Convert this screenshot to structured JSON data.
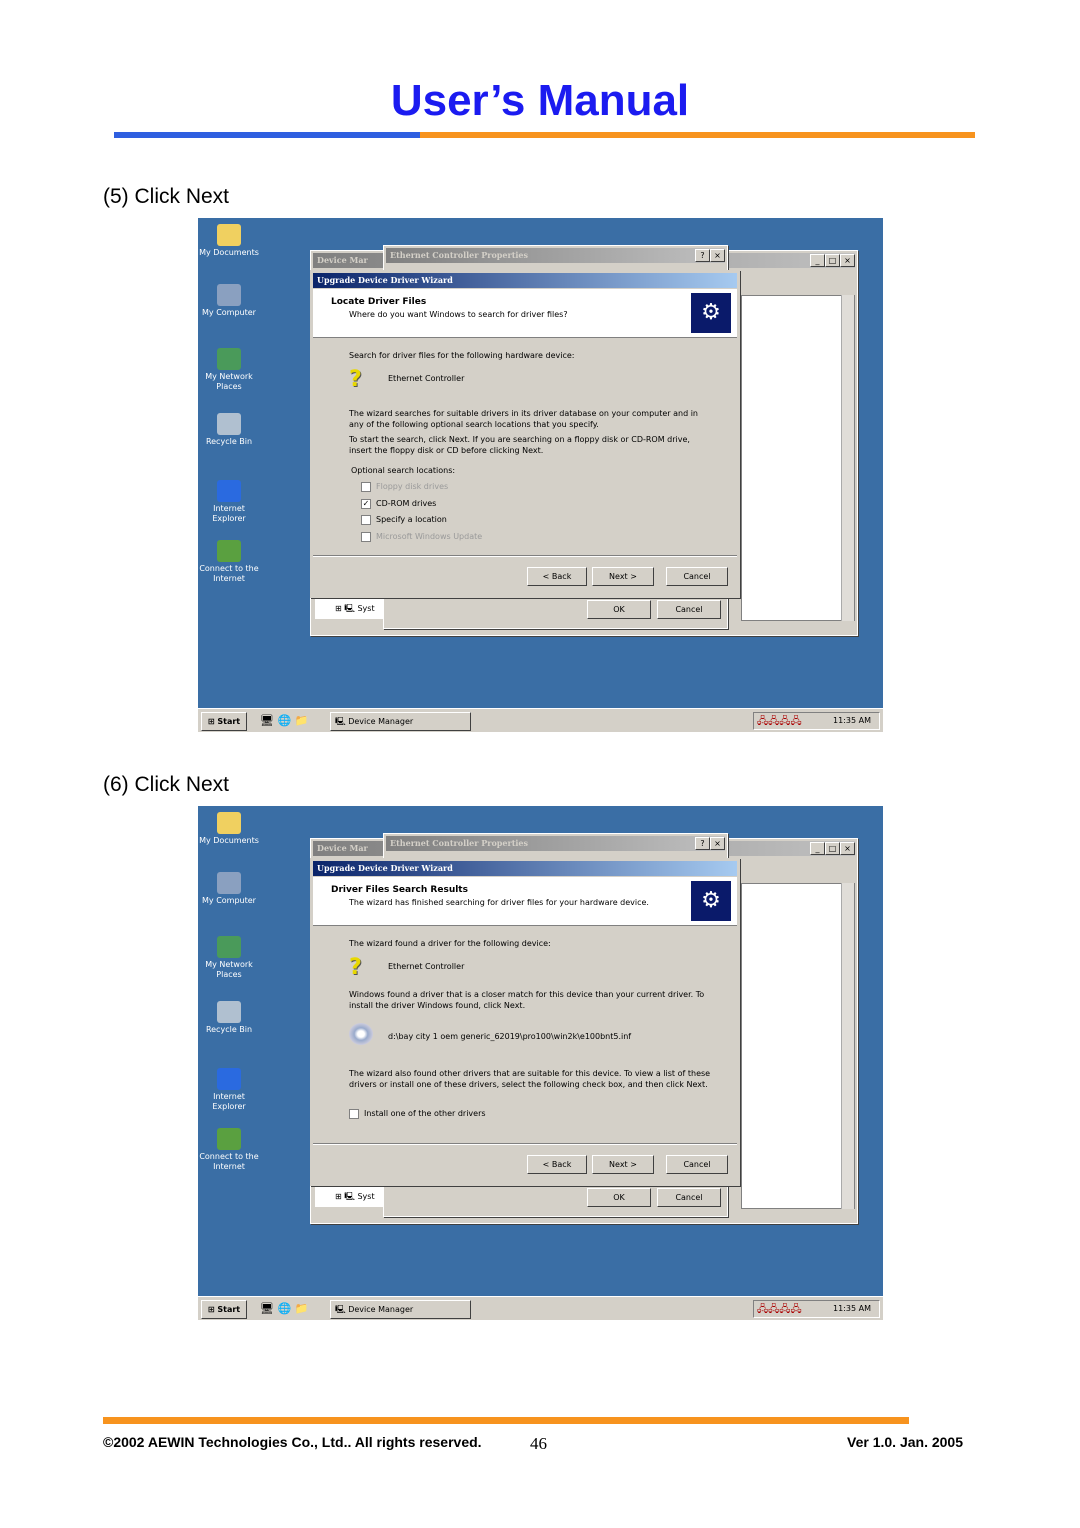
{
  "header": {
    "title": "User’s Manual",
    "colors": {
      "title": "#1b1bf0",
      "rule_left": "#2f5fe0",
      "rule_right": "#f7931e"
    }
  },
  "desktop": {
    "icons": [
      "My Documents",
      "My Computer",
      "My Network Places",
      "Recycle Bin",
      "Internet Explorer",
      "Connect to the Internet"
    ],
    "device_manager_title": "Device Mar",
    "properties_title": "Ethernet Controller Properties",
    "wizard_title": "Upgrade Device Driver Wizard",
    "tree_item": "Syst",
    "ok": "OK",
    "cancel": "Cancel",
    "back": "< Back",
    "next": "Next >",
    "taskbar": {
      "start": "Start",
      "task": "Device Manager",
      "clock": "11:35 AM"
    }
  },
  "steps": [
    {
      "caption": "(5) Click Next",
      "heading": "Locate Driver Files",
      "subheading": "Where do you want Windows to search for driver files?",
      "intro": "Search for driver files for the following hardware device:",
      "device": "Ethernet Controller",
      "para1": "The wizard searches for suitable drivers in its driver database on your computer and in any of the following optional search locations that you specify.",
      "para2": "To start the search, click Next. If you are searching on a floppy disk or CD-ROM drive, insert the floppy disk or CD before clicking Next.",
      "options_label": "Optional search locations:",
      "options": [
        {
          "label": "Floppy disk drives",
          "checked": false,
          "enabled": false
        },
        {
          "label": "CD-ROM drives",
          "checked": true,
          "enabled": true
        },
        {
          "label": "Specify a location",
          "checked": false,
          "enabled": true
        },
        {
          "label": "Microsoft Windows Update",
          "checked": false,
          "enabled": false
        }
      ]
    },
    {
      "caption": "(6) Click Next",
      "heading": "Driver Files Search Results",
      "subheading": "The wizard has finished searching for driver files for your hardware device.",
      "intro": "The wizard found a driver for the following device:",
      "device": "Ethernet Controller",
      "para1": "Windows found a driver that is a closer match for this device than your current driver. To install the driver Windows found, click Next.",
      "path": "d:\\bay city 1 oem generic_62019\\pro100\\win2k\\e100bnt5.inf",
      "para2": "The wizard also found other drivers that are suitable for this device. To view a list of these drivers or install one of these drivers, select the following check box, and then click Next.",
      "checkbox": {
        "label": "Install one of the other drivers",
        "checked": false
      }
    }
  ],
  "footer": {
    "copyright": "©2002 AEWIN Technologies Co., Ltd.. All rights reserved.",
    "page": "46",
    "version": "Ver 1.0. Jan. 2005"
  }
}
